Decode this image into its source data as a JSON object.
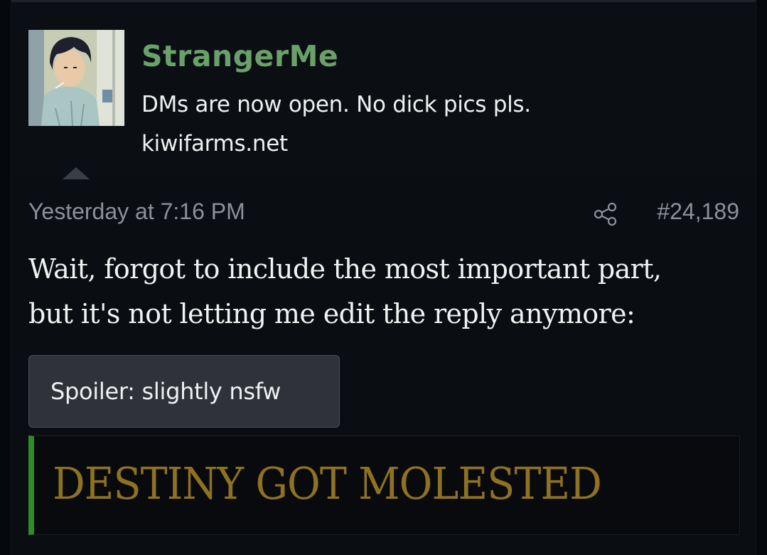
{
  "user": {
    "name": "StrangerMe",
    "title": "DMs are now open. No dick pics pls.",
    "site": "kiwifarms.net"
  },
  "post": {
    "timestamp": "Yesterday at 7:16 PM",
    "number": "#24,189",
    "body_lines": [
      "Wait, forgot to include the most important part,",
      "but it's not letting me edit the reply anymore:"
    ],
    "spoiler_label": "Spoiler: slightly nsfw",
    "quote_text": "DESTINY GOT MOLESTED"
  },
  "icons": {
    "share": "share-icon",
    "collapse": "caret-up-icon"
  },
  "colors": {
    "username": "#6aa06a",
    "quote_text": "#8e7222",
    "quote_accent": "#2f8a2a",
    "background": "#0a0d12"
  }
}
